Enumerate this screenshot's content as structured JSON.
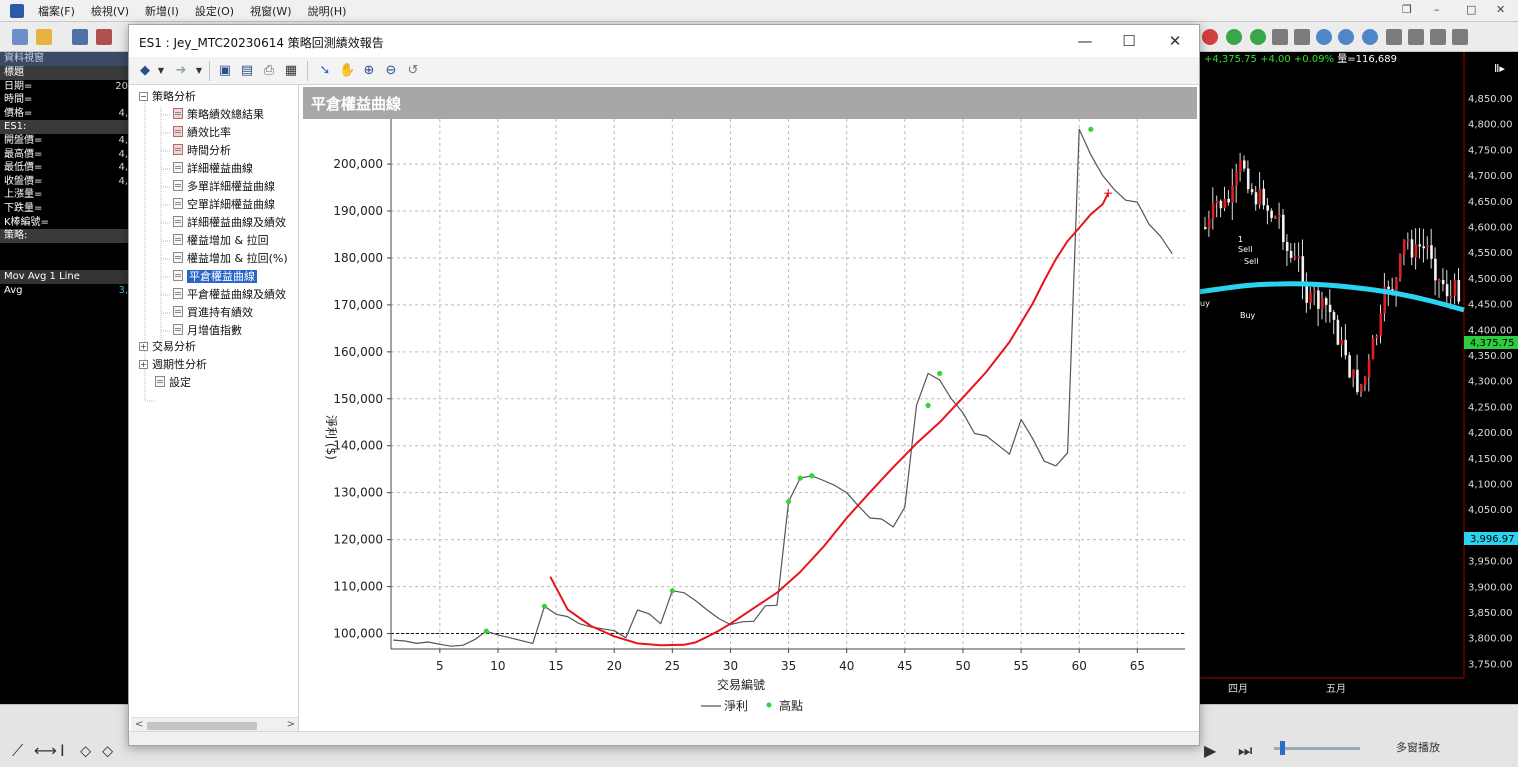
{
  "menubar": {
    "items": [
      "檔案(F)",
      "檢視(V)",
      "新增(I)",
      "設定(O)",
      "視窗(W)",
      "說明(H)"
    ]
  },
  "quote_panel": {
    "title": "資料視窗",
    "rows": [
      {
        "label": "標題",
        "value": "",
        "style": "head"
      },
      {
        "label": "日期=",
        "value": "20"
      },
      {
        "label": "時間=",
        "value": ""
      },
      {
        "label": "價格=",
        "value": "4,"
      },
      {
        "label": "ES1:",
        "value": "",
        "style": "head"
      },
      {
        "label": "開盤價=",
        "value": "4,"
      },
      {
        "label": "最高價=",
        "value": "4,"
      },
      {
        "label": "最低價=",
        "value": "4,"
      },
      {
        "label": "收盤價=",
        "value": "4,"
      },
      {
        "label": "上漲量=",
        "value": ""
      },
      {
        "label": "下跌量=",
        "value": ""
      },
      {
        "label": "K棒編號=",
        "value": ""
      },
      {
        "label": "策略:",
        "value": "",
        "style": "head"
      },
      {
        "label": "",
        "value": ""
      },
      {
        "label": "",
        "value": ""
      },
      {
        "label": "Mov Avg 1 Line",
        "value": "",
        "style": "sep"
      },
      {
        "label": "Avg",
        "value": "3,"
      }
    ]
  },
  "background_chart": {
    "status_change": "+4,375.75 +4.00 +0.09%",
    "status_volume": "量=116,689",
    "price_ticks": [
      "4,850.00",
      "4,800.00",
      "4,750.00",
      "4,700.00",
      "4,650.00",
      "4,600.00",
      "4,550.00",
      "4,500.00",
      "4,450.00",
      "4,400.00",
      "4,350.00",
      "4,300.00",
      "4,250.00",
      "4,200.00",
      "4,150.00",
      "4,100.00",
      "4,050.00",
      "4,000.00",
      "3,950.00",
      "3,900.00",
      "3,850.00",
      "3,800.00",
      "3,750.00"
    ],
    "last_price_tag": "4,375.75",
    "avg_tag": "3,996.97",
    "month_labels": [
      "四月",
      "五月"
    ],
    "trade_labels": [
      "1",
      "Sell",
      "Sell",
      "uy",
      "Buy"
    ]
  },
  "bottombar": {
    "multi_play_label": "多窗播放"
  },
  "report_window": {
    "title": "ES1 : Jey_MTC20230614 策略回測績效報告"
  },
  "tree": {
    "root": "策略分析",
    "items": [
      {
        "label": "策略績效總結果",
        "icon": "red"
      },
      {
        "label": "績效比率",
        "icon": "red"
      },
      {
        "label": "時間分析",
        "icon": "red"
      },
      {
        "label": "詳細權益曲線",
        "icon": "grid"
      },
      {
        "label": "多單詳細權益曲線",
        "icon": "grid"
      },
      {
        "label": "空單詳細權益曲線",
        "icon": "grid"
      },
      {
        "label": "詳細權益曲線及績效",
        "icon": "grid"
      },
      {
        "label": "權益增加 & 拉回",
        "icon": "grid"
      },
      {
        "label": "權益增加 & 拉回(%)",
        "icon": "grid"
      },
      {
        "label": "平倉權益曲線",
        "icon": "grid",
        "selected": true
      },
      {
        "label": "平倉權益曲線及績效",
        "icon": "grid"
      },
      {
        "label": "買進持有績效",
        "icon": "grid"
      },
      {
        "label": "月增值指數",
        "icon": "grid"
      }
    ],
    "groups": [
      "交易分析",
      "週期性分析"
    ],
    "settings": "設定"
  },
  "chart_header": {
    "title": "平倉權益曲線"
  },
  "chart_data": {
    "type": "line",
    "xlabel": "交易編號",
    "ylabel": "淨利 ($)",
    "xlim": [
      0.8,
      69.1
    ],
    "ylim": [
      96700,
      209600
    ],
    "x_ticks": [
      5,
      10,
      15,
      20,
      25,
      30,
      35,
      40,
      45,
      50,
      55,
      60,
      65
    ],
    "y_ticks": [
      100000,
      110000,
      120000,
      130000,
      140000,
      150000,
      160000,
      170000,
      180000,
      190000,
      200000
    ],
    "y_tick_labels": [
      "100,000",
      "110,000",
      "120,000",
      "130,000",
      "140,000",
      "150,000",
      "160,000",
      "170,000",
      "180,000",
      "190,000",
      "200,000"
    ],
    "baseline": 100000,
    "grid": true,
    "legend": {
      "position": "bottom",
      "items": [
        "淨利",
        "高點"
      ]
    },
    "series": [
      {
        "name": "淨利",
        "color": "#555555",
        "x": [
          1,
          2,
          3,
          4,
          5,
          6,
          7,
          8,
          9,
          10,
          11,
          12,
          13,
          14,
          15,
          16,
          17,
          18,
          19,
          20,
          21,
          22,
          23,
          24,
          25,
          26,
          27,
          28,
          29,
          30,
          31,
          32,
          33,
          34,
          35,
          36,
          37,
          38,
          39,
          40,
          41,
          42,
          43,
          44,
          45,
          46,
          47,
          48,
          49,
          50,
          51,
          52,
          53,
          54,
          55,
          56,
          57,
          58,
          59,
          60,
          61,
          62,
          63,
          64,
          65,
          66,
          67,
          68
        ],
        "values": [
          98600,
          98400,
          97900,
          98200,
          97700,
          97300,
          97500,
          98700,
          100500,
          99700,
          99100,
          98500,
          97900,
          105800,
          104100,
          103600,
          102100,
          101400,
          101000,
          100600,
          99100,
          105000,
          104200,
          102100,
          109100,
          108700,
          107000,
          105000,
          103200,
          101900,
          102500,
          102600,
          105900,
          106000,
          128100,
          133100,
          133600,
          132600,
          131500,
          130000,
          127200,
          124600,
          124400,
          122700,
          126900,
          148600,
          155400,
          154000,
          150000,
          147000,
          142600,
          142100,
          140200,
          138200,
          145600,
          141500,
          136700,
          135700,
          138500,
          207400,
          202000,
          197600,
          194600,
          192300,
          191900,
          187200,
          184600,
          180900
        ]
      },
      {
        "name": "高點",
        "type": "scatter",
        "color": "#33d43a",
        "x": [
          9,
          14,
          25,
          35,
          36,
          37,
          47,
          48,
          61
        ],
        "values": [
          100500,
          105800,
          109100,
          128100,
          133100,
          133600,
          148600,
          155400,
          207400
        ]
      },
      {
        "type": "line",
        "color": "#e8141b",
        "x": [
          14.5,
          16,
          18,
          20,
          22,
          24,
          26,
          27,
          28,
          29,
          30,
          32,
          34,
          36,
          38,
          40,
          42,
          44,
          46,
          48,
          50,
          52,
          54,
          56,
          57,
          58,
          59,
          60,
          61,
          62,
          62.5
        ],
        "values": [
          112100,
          105100,
          101600,
          99400,
          97900,
          97500,
          97600,
          98100,
          99300,
          100600,
          102100,
          105400,
          108700,
          113100,
          118500,
          124600,
          130100,
          135400,
          140500,
          145000,
          150300,
          155700,
          162100,
          170300,
          175200,
          179800,
          183600,
          186400,
          189300,
          191400,
          193800
        ]
      }
    ]
  }
}
